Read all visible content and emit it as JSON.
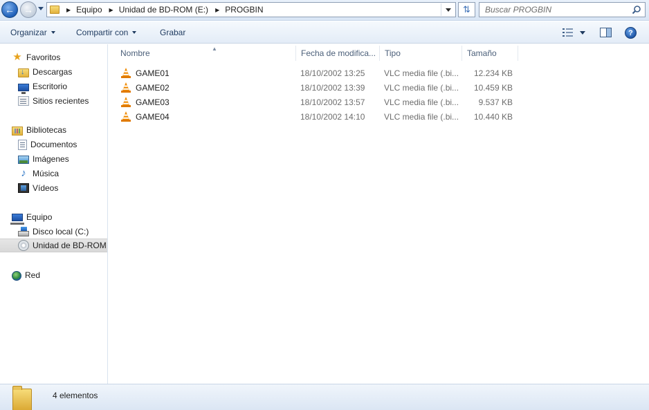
{
  "address": {
    "breadcrumbs": [
      "Equipo",
      "Unidad de BD-ROM (E:)",
      "PROGBIN"
    ]
  },
  "search": {
    "placeholder": "Buscar PROGBIN"
  },
  "toolbar": {
    "organize_label": "Organizar",
    "share_label": "Compartir con",
    "burn_label": "Grabar"
  },
  "sidebar": {
    "favorites": {
      "label": "Favoritos",
      "items": [
        {
          "label": "Descargas",
          "icon": "downloads-folder-icon"
        },
        {
          "label": "Escritorio",
          "icon": "desktop-icon"
        },
        {
          "label": "Sitios recientes",
          "icon": "recent-places-icon"
        }
      ]
    },
    "libraries": {
      "label": "Bibliotecas",
      "items": [
        {
          "label": "Documentos",
          "icon": "documents-icon"
        },
        {
          "label": "Imágenes",
          "icon": "pictures-icon"
        },
        {
          "label": "Música",
          "icon": "music-icon"
        },
        {
          "label": "Vídeos",
          "icon": "videos-icon"
        }
      ]
    },
    "computer": {
      "label": "Equipo",
      "items": [
        {
          "label": "Disco local (C:)",
          "icon": "local-disk-icon"
        },
        {
          "label": "Unidad de BD-ROM",
          "icon": "bd-rom-disc-icon",
          "selected": true
        }
      ]
    },
    "network": {
      "label": "Red"
    }
  },
  "columns": {
    "name": "Nombre",
    "date": "Fecha de modifica...",
    "type": "Tipo",
    "size": "Tamaño"
  },
  "files": [
    {
      "name": "GAME01",
      "date": "18/10/2002 13:25",
      "type": "VLC media file (.bi...",
      "size": "12.234 KB"
    },
    {
      "name": "GAME02",
      "date": "18/10/2002 13:39",
      "type": "VLC media file (.bi...",
      "size": "10.459 KB"
    },
    {
      "name": "GAME03",
      "date": "18/10/2002 13:57",
      "type": "VLC media file (.bi...",
      "size": "9.537 KB"
    },
    {
      "name": "GAME04",
      "date": "18/10/2002 14:10",
      "type": "VLC media file (.bi...",
      "size": "10.440 KB"
    }
  ],
  "status": {
    "item_count": "4 elementos"
  },
  "colors": {
    "selection": "#d9d9d9",
    "accent": "#1e5fb8",
    "vlc_orange": "#f08a00"
  }
}
